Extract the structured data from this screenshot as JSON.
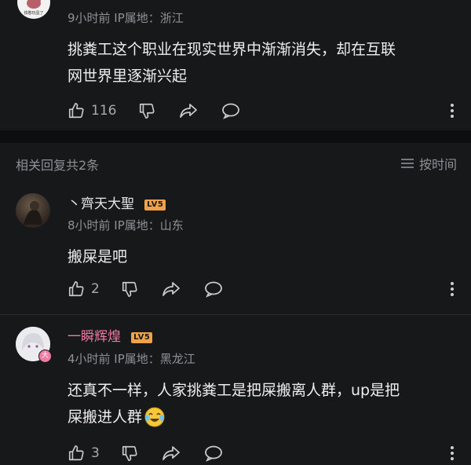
{
  "top_comment": {
    "avatar_caption": "铁憨玩蛋了",
    "meta": "9小时前 IP属地：浙江",
    "text_line1": "挑粪工这个职业在现实世界中渐渐消失，却在互联",
    "text_line2": "网世界里逐渐兴起",
    "like_count": "116"
  },
  "replies_header": {
    "title": "相关回复共2条",
    "sort_label": "按时间"
  },
  "replies": [
    {
      "username": "丶齊天大聖",
      "level": "LV5",
      "meta": "8小时前 IP属地：山东",
      "text": "搬屎是吧",
      "like_count": "2"
    },
    {
      "username": "一瞬辉煌",
      "level": "LV5",
      "avatar_badge": "大",
      "meta": "4小时前 IP属地：黑龙江",
      "text_line1": "还真不一样，人家挑粪工是把屎搬离人群，up是把",
      "text_line2": "屎搬进人群",
      "emoji": "laughing-crying-emoji",
      "like_count": "3"
    }
  ],
  "colors": {
    "background": "#17181a",
    "vip_name": "#f07ba4",
    "level_badge": "#f0a24a",
    "meta_text": "#8f9095"
  }
}
